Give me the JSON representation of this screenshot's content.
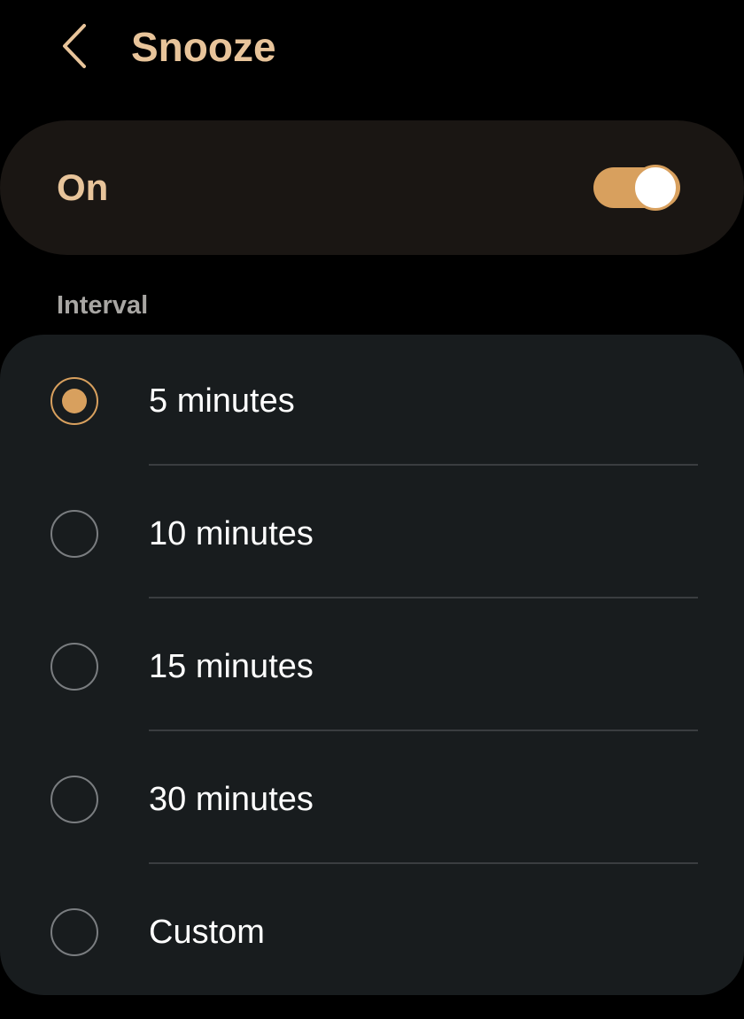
{
  "header": {
    "title": "Snooze",
    "back_icon": "chevron-left-icon"
  },
  "snooze_toggle": {
    "label": "On",
    "enabled": true
  },
  "interval": {
    "section_label": "Interval",
    "selected": "5 minutes",
    "options": [
      {
        "label": "5 minutes",
        "selected": true
      },
      {
        "label": "10 minutes",
        "selected": false
      },
      {
        "label": "15 minutes",
        "selected": false
      },
      {
        "label": "30 minutes",
        "selected": false
      },
      {
        "label": "Custom",
        "selected": false
      }
    ]
  },
  "colors": {
    "background": "#000000",
    "accent": "#d8a05e",
    "accent_text": "#e8c49a",
    "toggle_card_bg": "#1a1613",
    "options_card_bg": "#181c1e",
    "section_label": "#a8a6a3",
    "option_text": "#ffffff",
    "radio_unselected": "#7a7d80",
    "divider": "#3a3d40"
  }
}
